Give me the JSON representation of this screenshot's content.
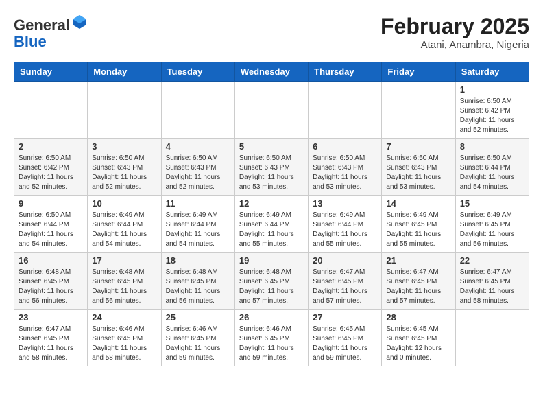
{
  "header": {
    "logo_general": "General",
    "logo_blue": "Blue",
    "month_title": "February 2025",
    "location": "Atani, Anambra, Nigeria"
  },
  "weekdays": [
    "Sunday",
    "Monday",
    "Tuesday",
    "Wednesday",
    "Thursday",
    "Friday",
    "Saturday"
  ],
  "weeks": [
    [
      {
        "day": "",
        "info": ""
      },
      {
        "day": "",
        "info": ""
      },
      {
        "day": "",
        "info": ""
      },
      {
        "day": "",
        "info": ""
      },
      {
        "day": "",
        "info": ""
      },
      {
        "day": "",
        "info": ""
      },
      {
        "day": "1",
        "info": "Sunrise: 6:50 AM\nSunset: 6:42 PM\nDaylight: 11 hours\nand 52 minutes."
      }
    ],
    [
      {
        "day": "2",
        "info": "Sunrise: 6:50 AM\nSunset: 6:42 PM\nDaylight: 11 hours\nand 52 minutes."
      },
      {
        "day": "3",
        "info": "Sunrise: 6:50 AM\nSunset: 6:43 PM\nDaylight: 11 hours\nand 52 minutes."
      },
      {
        "day": "4",
        "info": "Sunrise: 6:50 AM\nSunset: 6:43 PM\nDaylight: 11 hours\nand 52 minutes."
      },
      {
        "day": "5",
        "info": "Sunrise: 6:50 AM\nSunset: 6:43 PM\nDaylight: 11 hours\nand 53 minutes."
      },
      {
        "day": "6",
        "info": "Sunrise: 6:50 AM\nSunset: 6:43 PM\nDaylight: 11 hours\nand 53 minutes."
      },
      {
        "day": "7",
        "info": "Sunrise: 6:50 AM\nSunset: 6:43 PM\nDaylight: 11 hours\nand 53 minutes."
      },
      {
        "day": "8",
        "info": "Sunrise: 6:50 AM\nSunset: 6:44 PM\nDaylight: 11 hours\nand 54 minutes."
      }
    ],
    [
      {
        "day": "9",
        "info": "Sunrise: 6:50 AM\nSunset: 6:44 PM\nDaylight: 11 hours\nand 54 minutes."
      },
      {
        "day": "10",
        "info": "Sunrise: 6:49 AM\nSunset: 6:44 PM\nDaylight: 11 hours\nand 54 minutes."
      },
      {
        "day": "11",
        "info": "Sunrise: 6:49 AM\nSunset: 6:44 PM\nDaylight: 11 hours\nand 54 minutes."
      },
      {
        "day": "12",
        "info": "Sunrise: 6:49 AM\nSunset: 6:44 PM\nDaylight: 11 hours\nand 55 minutes."
      },
      {
        "day": "13",
        "info": "Sunrise: 6:49 AM\nSunset: 6:44 PM\nDaylight: 11 hours\nand 55 minutes."
      },
      {
        "day": "14",
        "info": "Sunrise: 6:49 AM\nSunset: 6:45 PM\nDaylight: 11 hours\nand 55 minutes."
      },
      {
        "day": "15",
        "info": "Sunrise: 6:49 AM\nSunset: 6:45 PM\nDaylight: 11 hours\nand 56 minutes."
      }
    ],
    [
      {
        "day": "16",
        "info": "Sunrise: 6:48 AM\nSunset: 6:45 PM\nDaylight: 11 hours\nand 56 minutes."
      },
      {
        "day": "17",
        "info": "Sunrise: 6:48 AM\nSunset: 6:45 PM\nDaylight: 11 hours\nand 56 minutes."
      },
      {
        "day": "18",
        "info": "Sunrise: 6:48 AM\nSunset: 6:45 PM\nDaylight: 11 hours\nand 56 minutes."
      },
      {
        "day": "19",
        "info": "Sunrise: 6:48 AM\nSunset: 6:45 PM\nDaylight: 11 hours\nand 57 minutes."
      },
      {
        "day": "20",
        "info": "Sunrise: 6:47 AM\nSunset: 6:45 PM\nDaylight: 11 hours\nand 57 minutes."
      },
      {
        "day": "21",
        "info": "Sunrise: 6:47 AM\nSunset: 6:45 PM\nDaylight: 11 hours\nand 57 minutes."
      },
      {
        "day": "22",
        "info": "Sunrise: 6:47 AM\nSunset: 6:45 PM\nDaylight: 11 hours\nand 58 minutes."
      }
    ],
    [
      {
        "day": "23",
        "info": "Sunrise: 6:47 AM\nSunset: 6:45 PM\nDaylight: 11 hours\nand 58 minutes."
      },
      {
        "day": "24",
        "info": "Sunrise: 6:46 AM\nSunset: 6:45 PM\nDaylight: 11 hours\nand 58 minutes."
      },
      {
        "day": "25",
        "info": "Sunrise: 6:46 AM\nSunset: 6:45 PM\nDaylight: 11 hours\nand 59 minutes."
      },
      {
        "day": "26",
        "info": "Sunrise: 6:46 AM\nSunset: 6:45 PM\nDaylight: 11 hours\nand 59 minutes."
      },
      {
        "day": "27",
        "info": "Sunrise: 6:45 AM\nSunset: 6:45 PM\nDaylight: 11 hours\nand 59 minutes."
      },
      {
        "day": "28",
        "info": "Sunrise: 6:45 AM\nSunset: 6:45 PM\nDaylight: 12 hours\nand 0 minutes."
      },
      {
        "day": "",
        "info": ""
      }
    ]
  ]
}
